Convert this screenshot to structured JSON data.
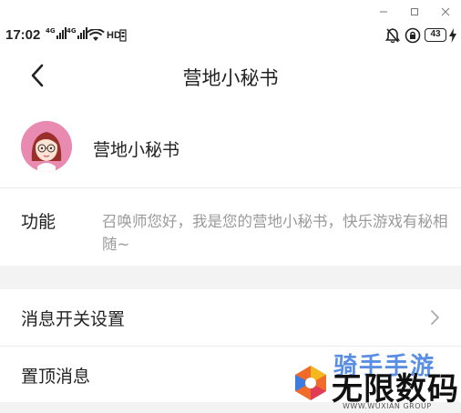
{
  "window": {
    "controls": [
      "minimize-icon",
      "maximize-icon",
      "close-icon"
    ]
  },
  "status_bar": {
    "time": "17:02",
    "network_1": "4G",
    "network_2": "4G",
    "wifi_label": "HD",
    "battery": "43",
    "icons": [
      "bell-off-icon",
      "lock-rotation-icon",
      "battery-icon",
      "charging-icon",
      "wifi-icon",
      "signal-icon"
    ]
  },
  "nav": {
    "title": "营地小秘书",
    "back_icon": "chevron-left-icon"
  },
  "profile": {
    "name": "营地小秘书",
    "avatar_icon": "avatar-girl-icon",
    "avatar_color": "#e98ab0"
  },
  "feature": {
    "label": "功能",
    "description": "召唤师您好，我是您的营地小秘书，快乐游戏有秘相随~"
  },
  "settings": {
    "message_switch": "消息开关设置",
    "pin_message": "置顶消息"
  },
  "watermark": {
    "top": "骑手手游",
    "main": "无限数码",
    "sub": "WWW.WUXIAN GROUP"
  },
  "colors": {
    "text": "#222222",
    "secondary": "#9a9a9a",
    "gap": "#f3f3f3",
    "watermark_blue": "#3d7be0"
  }
}
